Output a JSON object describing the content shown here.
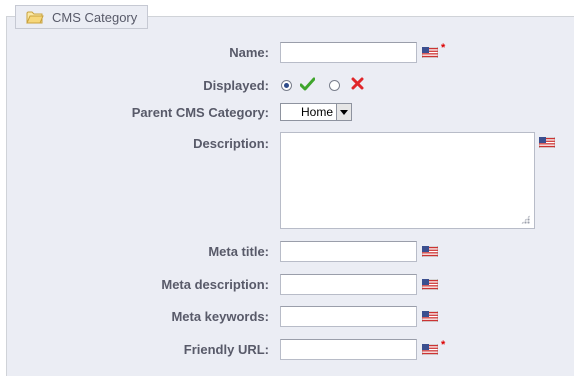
{
  "legend": {
    "title": "CMS Category",
    "icon": "folder-icon"
  },
  "fields": {
    "name_label": "Name:",
    "displayed_label": "Displayed:",
    "parent_label": "Parent CMS Category:",
    "parent_selected": "Home",
    "description_label": "Description:",
    "meta_title_label": "Meta title:",
    "meta_description_label": "Meta description:",
    "meta_keywords_label": "Meta keywords:",
    "friendly_url_label": "Friendly URL:",
    "required_mark": "*"
  },
  "displayed": {
    "selected": "yes",
    "yes_icon": "check-icon",
    "no_icon": "cross-icon"
  },
  "values": {
    "name": "",
    "description": "",
    "meta_title": "",
    "meta_description": "",
    "meta_keywords": "",
    "friendly_url": ""
  },
  "colors": {
    "panel_bg": "#ebedf4",
    "yes_green": "#3fa52c",
    "no_red": "#e0262a",
    "required_red": "#dd0000"
  }
}
